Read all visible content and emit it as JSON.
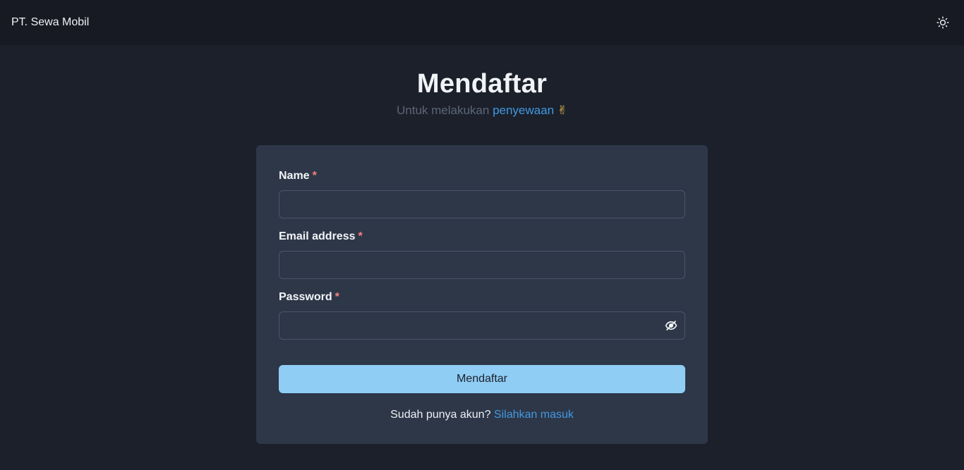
{
  "navbar": {
    "brand": "PT. Sewa Mobil",
    "theme_toggle_icon": "sun-icon"
  },
  "heading": {
    "title": "Mendaftar",
    "subtitle_prefix": "Untuk melakukan ",
    "subtitle_link": "penyewaan",
    "subtitle_emoji": "✌"
  },
  "form": {
    "required_marker": "*",
    "fields": [
      {
        "label": "Name",
        "value": "",
        "placeholder": ""
      },
      {
        "label": "Email address",
        "value": "",
        "placeholder": ""
      },
      {
        "label": "Password",
        "value": "",
        "placeholder": "",
        "toggle_icon": "eye-off-icon"
      }
    ],
    "submit_label": "Mendaftar",
    "login_prompt": "Sudah punya akun? ",
    "login_link": "Silahkan masuk"
  },
  "colors": {
    "page_bg": "#1b202b",
    "navbar_bg": "#171a22",
    "card_bg": "#2d3748",
    "accent_link": "#4299e1",
    "button_bg": "#90cdf4",
    "required": "#fc8181"
  }
}
